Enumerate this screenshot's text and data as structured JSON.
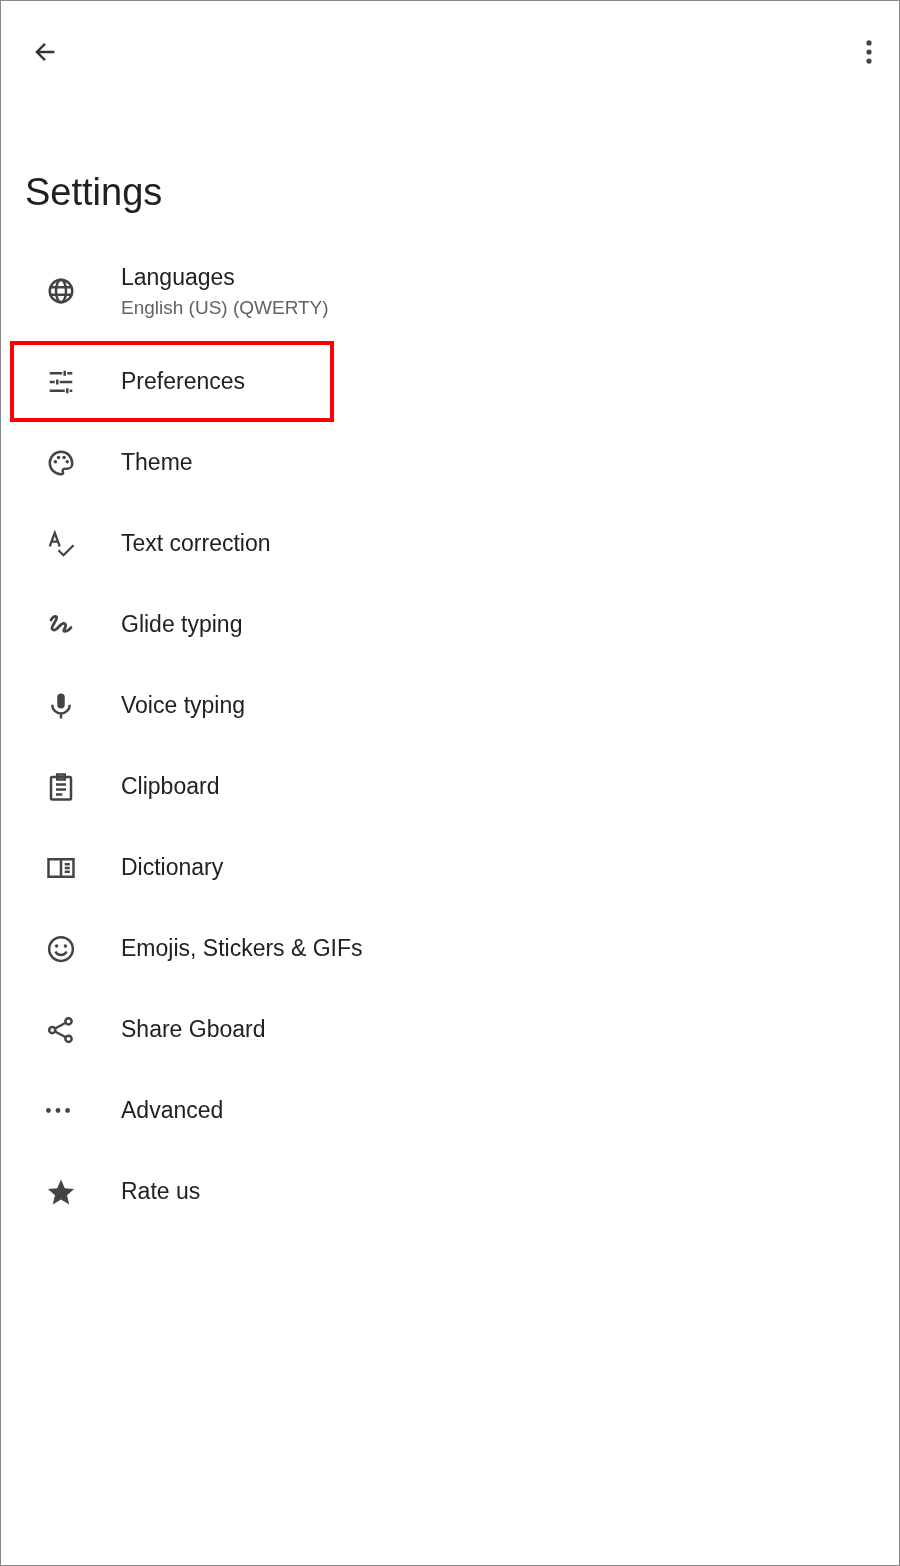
{
  "title": "Settings",
  "items": [
    {
      "kind": "globe",
      "label": "Languages",
      "subtitle": "English (US) (QWERTY)",
      "highlighted": false
    },
    {
      "kind": "tune",
      "label": "Preferences",
      "highlighted": true
    },
    {
      "kind": "palette",
      "label": "Theme",
      "highlighted": false
    },
    {
      "kind": "spellcheck",
      "label": "Text correction",
      "highlighted": false
    },
    {
      "kind": "gesture",
      "label": "Glide typing",
      "highlighted": false
    },
    {
      "kind": "mic",
      "label": "Voice typing",
      "highlighted": false
    },
    {
      "kind": "clipboard",
      "label": "Clipboard",
      "highlighted": false
    },
    {
      "kind": "book",
      "label": "Dictionary",
      "highlighted": false
    },
    {
      "kind": "smiley",
      "label": "Emojis, Stickers & GIFs",
      "highlighted": false
    },
    {
      "kind": "share",
      "label": "Share Gboard",
      "highlighted": false
    },
    {
      "kind": "dots",
      "label": "Advanced",
      "highlighted": false
    },
    {
      "kind": "star",
      "label": "Rate us",
      "highlighted": false
    }
  ]
}
